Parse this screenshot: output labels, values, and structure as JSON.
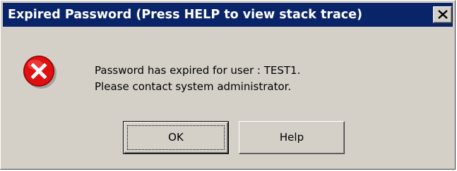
{
  "window": {
    "title": "Expired Password (Press HELP to view stack trace)",
    "close_icon": "close-icon",
    "titlebar_color": "#0a246a",
    "face_color": "#d4d0c8"
  },
  "message": {
    "icon": "error-icon",
    "icon_color": "#e01010",
    "line1": "Password has expired for user : TEST1.",
    "line2": "Please contact system administrator."
  },
  "buttons": {
    "ok_label": "OK",
    "help_label": "Help",
    "default": "OK"
  }
}
